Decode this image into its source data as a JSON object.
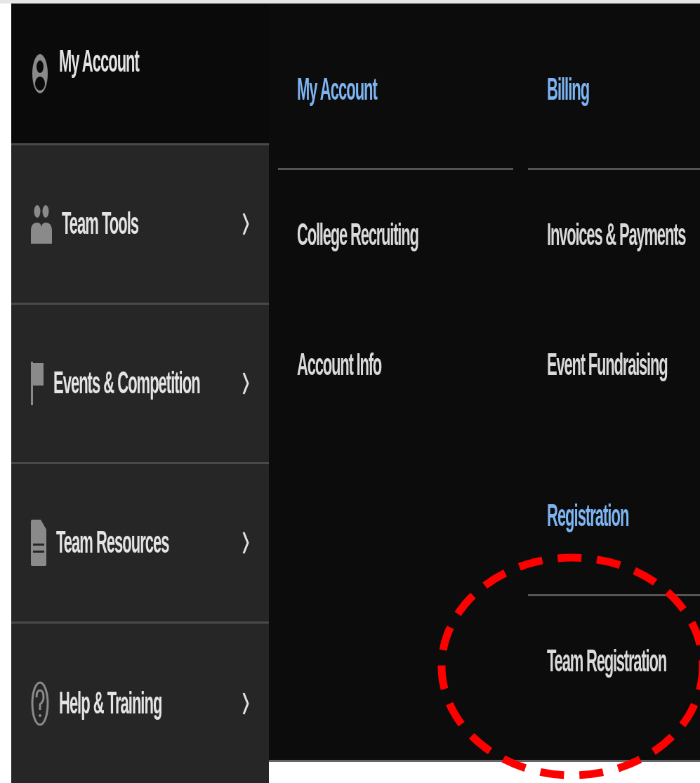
{
  "sidebar": {
    "items": [
      {
        "label": "My Account",
        "kind": "user",
        "submenu": false,
        "selected": true
      },
      {
        "label": "Team Tools",
        "kind": "people",
        "submenu": true,
        "selected": false
      },
      {
        "label": "Events & Competition",
        "kind": "flag",
        "submenu": true,
        "selected": false
      },
      {
        "label": "Team Resources",
        "kind": "document",
        "submenu": true,
        "selected": false
      },
      {
        "label": "Help & Training",
        "kind": "help",
        "submenu": true,
        "selected": false
      }
    ]
  },
  "menu": {
    "columns": [
      {
        "sections": [
          {
            "heading": "My Account",
            "links": [
              "College Recruiting",
              "Account Info"
            ]
          }
        ]
      },
      {
        "sections": [
          {
            "heading": "Billing",
            "links": [
              "Invoices & Payments",
              "Event Fundraising"
            ]
          },
          {
            "heading": "Registration",
            "links": [
              "Team Registration"
            ]
          }
        ]
      }
    ]
  }
}
